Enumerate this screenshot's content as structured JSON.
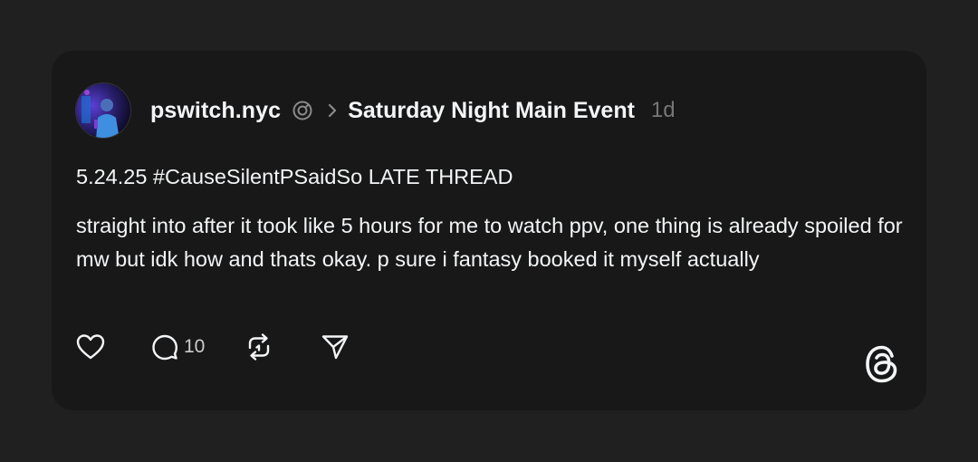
{
  "post": {
    "username": "pswitch.nyc",
    "community": "Saturday Night Main Event",
    "timestamp": "1d",
    "title": "5.24.25 #CauseSilentPSaidSo LATE THREAD",
    "body": "straight into after it took like 5 hours for me to watch ppv, one thing is already spoiled for mw but idk how and thats okay. p sure i fantasy booked it myself actually"
  },
  "actions": {
    "reply_count": "10"
  },
  "icons": {
    "avatar": "avatar-image",
    "verified": "threads-badge-icon",
    "chevron": "chevron-right-icon",
    "like": "heart-icon",
    "reply": "comment-icon",
    "repost": "repost-icon",
    "share": "send-icon",
    "brand": "threads-logo-icon"
  },
  "colors": {
    "background": "#202020",
    "card": "#181818",
    "text": "#f3f5f7",
    "muted": "#777777"
  }
}
